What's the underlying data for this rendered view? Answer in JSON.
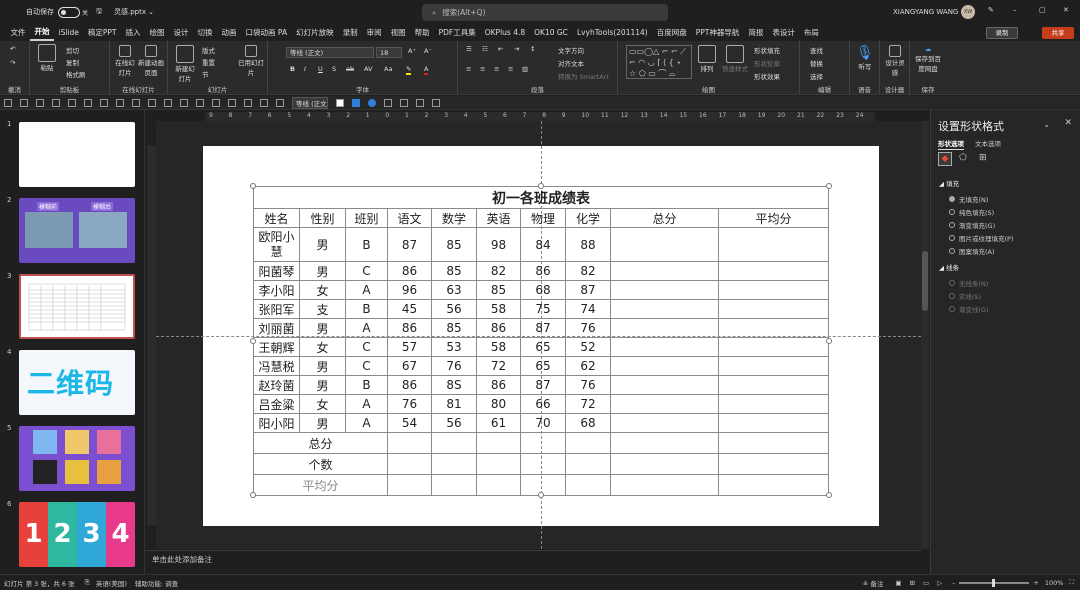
{
  "titlebar": {
    "autosave_label": "自动保存",
    "autosave_state": "关",
    "filename": "灵感.pptx",
    "search_placeholder": "搜索(Alt+Q)",
    "user_name": "XIANGYANG WANG",
    "avatar_initials": "XW"
  },
  "menu": [
    "文件",
    "开始",
    "iSlide",
    "稿定PPT",
    "插入",
    "绘图",
    "设计",
    "切换",
    "动画",
    "口袋动画 PA",
    "幻灯片放映",
    "录制",
    "审阅",
    "视图",
    "帮助",
    "PDF工具集",
    "OKPlus 4.8",
    "OK10 GC",
    "LvyhTools(201114)",
    "百度网盘",
    "PPT神器导航",
    "简报",
    "表设计",
    "布局"
  ],
  "active_menu": "开始",
  "menu_right": {
    "record": "录制",
    "share": "共享"
  },
  "ribbon": {
    "groups": [
      "撤消",
      "剪贴板",
      "在线幻灯片",
      "幻灯片",
      "字体",
      "段落",
      "绘图",
      "编辑",
      "语音",
      "设计器",
      "保存"
    ],
    "undo": "撤消",
    "paste": "粘贴",
    "cut": "剪切",
    "copy": "复制",
    "format_painter": "格式刷",
    "online_slides": "在线幻灯片",
    "new_online": "新建动画页面",
    "new_slide": "新建幻灯片",
    "layout": "版式",
    "reset": "重置",
    "section": "节",
    "reuse": "已用幻灯片",
    "font_name": "等线 (正文)",
    "font_size": "18",
    "text_direction": "文字方向",
    "align_text": "对齐文本",
    "smartart": "转换为 SmartArt",
    "arrange": "排列",
    "quick_styles": "快速样式",
    "shape_fill": "形状填充",
    "shape_outline": "形状轮廓",
    "shape_effect": "形状效果",
    "find": "查找",
    "replace": "替换",
    "select": "选择",
    "dictate": "听写",
    "designer": "设计灵感",
    "save_baidu": "保存到百度网盘"
  },
  "toolbar2": {
    "font_name": "等线 (正文)"
  },
  "ruler": [
    "9",
    "8",
    "7",
    "6",
    "5",
    "4",
    "3",
    "2",
    "1",
    "0",
    "1",
    "2",
    "3",
    "4",
    "5",
    "6",
    "7",
    "8",
    "9",
    "10",
    "11",
    "12",
    "13",
    "14",
    "15",
    "16",
    "17",
    "18",
    "19",
    "20",
    "21",
    "22",
    "23",
    "24"
  ],
  "slides": {
    "numbers": [
      "1",
      "2",
      "3",
      "4",
      "5",
      "6"
    ],
    "thumb2_tags": [
      "模糊前",
      "模糊后"
    ],
    "thumb4_text": "二维码",
    "thumb6_digits": [
      "1",
      "2",
      "3",
      "4"
    ]
  },
  "table": {
    "title": "初一各班成绩表",
    "headers": [
      "姓名",
      "性别",
      "班别",
      "语文",
      "数学",
      "英语",
      "物理",
      "化学",
      "总分",
      "平均分"
    ],
    "rows": [
      [
        "欧阳小慧",
        "男",
        "B",
        "87",
        "85",
        "98",
        "84",
        "88",
        "",
        ""
      ],
      [
        "阳菌琴",
        "男",
        "C",
        "86",
        "85",
        "82",
        "86",
        "82",
        "",
        ""
      ],
      [
        "李小阳",
        "女",
        "A",
        "96",
        "63",
        "85",
        "68",
        "87",
        "",
        ""
      ],
      [
        "张阳军",
        "支",
        "B",
        "45",
        "56",
        "58",
        "75",
        "74",
        "",
        ""
      ],
      [
        "刘丽菌",
        "男",
        "A",
        "86",
        "85",
        "86",
        "87",
        "76",
        "",
        ""
      ],
      [
        "王朝辉",
        "女",
        "C",
        "57",
        "53",
        "58",
        "65",
        "52",
        "",
        ""
      ],
      [
        "冯慧税",
        "男",
        "C",
        "67",
        "76",
        "72",
        "65",
        "62",
        "",
        ""
      ],
      [
        "赵玲菌",
        "男",
        "B",
        "86",
        "8S",
        "86",
        "87",
        "76",
        "",
        ""
      ],
      [
        "吕金粱",
        "女",
        "A",
        "76",
        "81",
        "80",
        "66",
        "72",
        "",
        ""
      ],
      [
        "阳小阳",
        "男",
        "A",
        "54",
        "56",
        "61",
        "70",
        "68",
        "",
        ""
      ]
    ],
    "footer": [
      "总分",
      "个数",
      "平均分"
    ]
  },
  "notes_placeholder": "单击此处添加备注",
  "pane": {
    "title": "设置形状格式",
    "tabs": [
      "形状选项",
      "文本选项"
    ],
    "fill_section": "填充",
    "fill_options": [
      "无填充(N)",
      "纯色填充(S)",
      "渐变填充(G)",
      "图片或纹理填充(P)",
      "图案填充(A)"
    ],
    "line_section": "线条",
    "line_options": [
      "无线条(N)",
      "实线(S)",
      "渐变线(G)"
    ]
  },
  "status": {
    "slide_info": "幻灯片 第 3 张，共 6 张",
    "language": "英语(美国)",
    "accessibility": "辅助功能: 调查",
    "notes": "备注",
    "zoom": "100%"
  }
}
